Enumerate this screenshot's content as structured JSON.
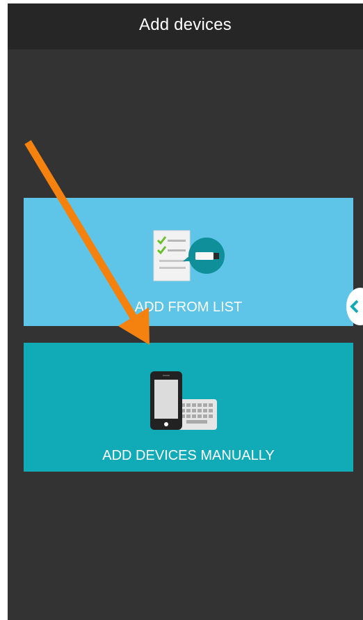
{
  "header": {
    "title": "Add devices"
  },
  "cards": {
    "from_list": {
      "label": "ADD FROM LIST",
      "icon": "checklist-device-icon",
      "color": "#5ec4e8"
    },
    "manual": {
      "label": "ADD DEVICES MANUALLY",
      "icon": "phone-keyboard-icon",
      "color": "#11aab7"
    }
  },
  "annotation": {
    "icon": "orange-arrow",
    "color": "#f5820f"
  },
  "side_handle": {
    "icon": "chevron-left-icon"
  },
  "colors": {
    "background": "#333333",
    "header": "#262626"
  }
}
